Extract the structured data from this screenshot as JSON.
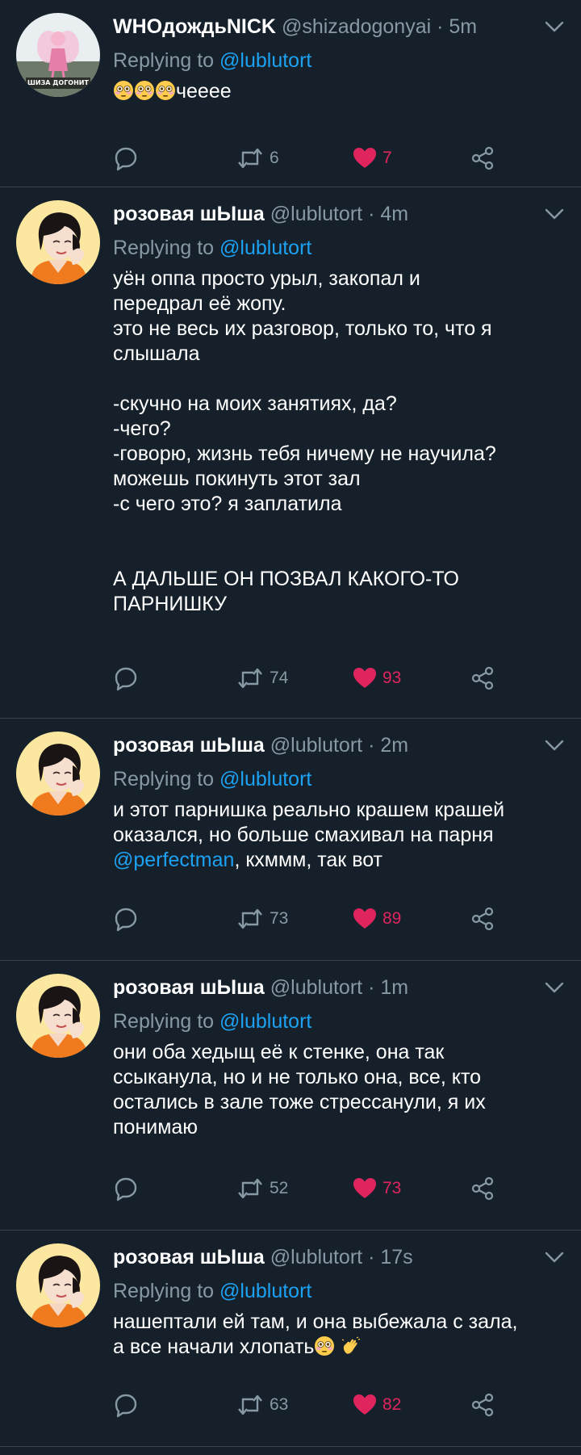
{
  "colors": {
    "background": "#15202b",
    "separator": "#38444d",
    "secondary_text": "#8899a6",
    "link": "#1da1f2",
    "like": "#e0245e"
  },
  "tweets": [
    {
      "display_name": "WHOдождьNICK",
      "handle": "@shizadogonyai",
      "time": "5m",
      "replying_prefix": "Replying to ",
      "replying_to": "@lublutort",
      "text": "чееее",
      "leading_emoji": [
        "flushed-face",
        "flushed-face",
        "flushed-face"
      ],
      "retweets": "6",
      "likes": "7",
      "avatar": "pink-figure-avatar",
      "avatar_caption": "ШИЗА ДОГОНИТ"
    },
    {
      "display_name": "розовая шЫша",
      "handle": "@lublutort",
      "time": "4m",
      "replying_prefix": "Replying to ",
      "replying_to": "@lublutort",
      "text": "уён оппа просто урыл, закопал и\nпередрал её жопу.\nэто не весь их разговор, только то, что я\nслышала\n\n-скучно на моих занятиях, да?\n-чего?\n-говорю, жизнь тебя ничему не научила?\nможешь покинуть этот зал\n-с чего это? я заплатила\n\n\nА ДАЛЬШЕ ОН ПОЗВАЛ КАКОГО-ТО\nПАРНИШКУ",
      "retweets": "74",
      "likes": "93",
      "avatar": "anime-boy-avatar"
    },
    {
      "display_name": "розовая шЫша",
      "handle": "@lublutort",
      "time": "2m",
      "replying_prefix": "Replying to ",
      "replying_to": "@lublutort",
      "text_before": "и этот парнишка реально крашем крашей\nоказался, но больше смахивал на парня\n",
      "text_mention": "@perfectman",
      "text_after": ", кхммм, так вот",
      "retweets": "73",
      "likes": "89",
      "avatar": "anime-boy-avatar"
    },
    {
      "display_name": "розовая шЫша",
      "handle": "@lublutort",
      "time": "1m",
      "replying_prefix": "Replying to ",
      "replying_to": "@lublutort",
      "text": "они оба хедыщ её к стенке, она так\nссыканула, но и не только она, все, кто\nостались в зале тоже стрессанули, я их\nпонимаю",
      "retweets": "52",
      "likes": "73",
      "avatar": "anime-boy-avatar"
    },
    {
      "display_name": "розовая шЫша",
      "handle": "@lublutort",
      "time": "17s",
      "replying_prefix": "Replying to ",
      "replying_to": "@lublutort",
      "text": "нашептали ей там, и она выбежала с зала,\nа все начали хлопать",
      "trailing_emoji": [
        "flushed-face",
        "waving-hand"
      ],
      "retweets": "63",
      "likes": "82",
      "avatar": "anime-boy-avatar"
    }
  ],
  "icons": {
    "reply": "reply-icon",
    "retweet": "retweet-icon",
    "like": "heart-icon",
    "share": "share-icon",
    "more": "chevron-down-icon"
  }
}
